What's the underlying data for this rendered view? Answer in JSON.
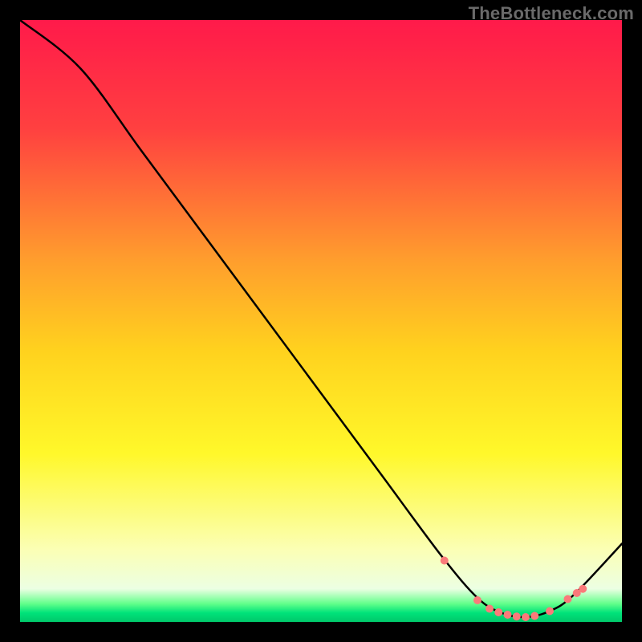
{
  "watermark": "TheBottleneck.com",
  "chart_data": {
    "type": "line",
    "title": "",
    "xlabel": "",
    "ylabel": "",
    "xlim": [
      0,
      100
    ],
    "ylim": [
      0,
      100
    ],
    "grid": false,
    "legend": false,
    "background_gradient_stops": [
      {
        "offset": 0.0,
        "color": "#ff1a4a"
      },
      {
        "offset": 0.18,
        "color": "#ff4040"
      },
      {
        "offset": 0.4,
        "color": "#ff9e2d"
      },
      {
        "offset": 0.55,
        "color": "#ffd21e"
      },
      {
        "offset": 0.72,
        "color": "#fff82a"
      },
      {
        "offset": 0.88,
        "color": "#fbffb5"
      },
      {
        "offset": 0.945,
        "color": "#ecffe3"
      },
      {
        "offset": 0.97,
        "color": "#60ff8a"
      },
      {
        "offset": 0.985,
        "color": "#00e27a"
      },
      {
        "offset": 1.0,
        "color": "#00c86a"
      }
    ],
    "series": [
      {
        "name": "curve",
        "color": "#000000",
        "stroke_width": 2.5,
        "x": [
          0,
          10,
          20,
          30,
          40,
          50,
          60,
          70,
          76,
          80,
          84,
          88,
          92,
          100
        ],
        "y": [
          100,
          92,
          78.5,
          65,
          51.5,
          38,
          24.5,
          11,
          4,
          1.5,
          0.8,
          1.8,
          4.5,
          13
        ]
      }
    ],
    "markers": {
      "color": "#fa7a7a",
      "radius": 5,
      "x": [
        70.5,
        76,
        78,
        79.5,
        81,
        82.5,
        84,
        85.5,
        88,
        91,
        92.5,
        93.5
      ],
      "y": [
        10.2,
        3.6,
        2.2,
        1.6,
        1.2,
        0.9,
        0.8,
        1.0,
        1.8,
        3.8,
        4.8,
        5.5
      ]
    }
  }
}
